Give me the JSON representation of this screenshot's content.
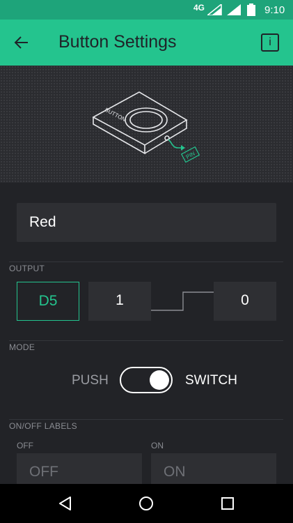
{
  "status": {
    "network": "4G",
    "time": "9:10"
  },
  "header": {
    "title": "Button Settings",
    "info_label": "i"
  },
  "illustration": {
    "device_label": "BUTTON",
    "pin_label": "PIN"
  },
  "name": {
    "value": "Red"
  },
  "output": {
    "section_label": "OUTPUT",
    "pin": "D5",
    "high_value": "1",
    "low_value": "0"
  },
  "mode": {
    "section_label": "MODE",
    "push_label": "PUSH",
    "switch_label": "SWITCH",
    "selected": "SWITCH"
  },
  "labels": {
    "section_label": "ON/OFF LABELS",
    "off_caption": "OFF",
    "on_caption": "ON",
    "off_placeholder": "OFF",
    "on_placeholder": "ON"
  },
  "colors": {
    "accent": "#24c48e",
    "background": "#222327",
    "field": "#2e2f33"
  }
}
